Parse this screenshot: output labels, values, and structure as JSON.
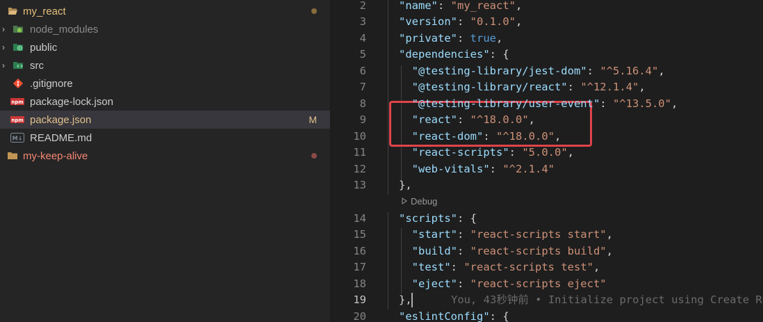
{
  "explorer": {
    "items": [
      {
        "label": "my_react",
        "type": "folder-open",
        "color": "#e5c07b",
        "status": "dot",
        "status_color": "#8a6d3b"
      },
      {
        "label": "node_modules",
        "type": "folder-node",
        "color": "#8c8c8c",
        "status": ""
      },
      {
        "label": "public",
        "type": "folder-public",
        "color": "#cccccc",
        "status": ""
      },
      {
        "label": "src",
        "type": "folder-src",
        "color": "#cccccc",
        "status": ""
      },
      {
        "label": ".gitignore",
        "type": "git",
        "color": "#cccccc",
        "status": ""
      },
      {
        "label": "package-lock.json",
        "type": "npm",
        "color": "#cccccc",
        "status": ""
      },
      {
        "label": "package.json",
        "type": "npm",
        "color": "#e2c08d",
        "status": "M",
        "status_color": "#e2c08d"
      },
      {
        "label": "README.md",
        "type": "markdown",
        "color": "#cccccc",
        "status": ""
      },
      {
        "label": "my-keep-alive",
        "type": "folder-closed",
        "color": "#f48771",
        "status": "dot",
        "status_color": "#8b4a45"
      }
    ],
    "readme_icon_text": "M↓",
    "npm_icon_text": "npm"
  },
  "editor": {
    "line_numbers": [
      "2",
      "3",
      "4",
      "5",
      "6",
      "7",
      "8",
      "9",
      "10",
      "11",
      "12",
      "13",
      "14",
      "15",
      "16",
      "17",
      "18",
      "19",
      "20"
    ],
    "active_line": "19",
    "codelens": "Debug",
    "blame": "You, 43秒钟前 • Initialize project using Create Re",
    "lines": [
      [
        {
          "t": "k",
          "v": "\"name\""
        },
        {
          "t": "p",
          "v": ": "
        },
        {
          "t": "s",
          "v": "\"my_react\""
        },
        {
          "t": "p",
          "v": ","
        }
      ],
      [
        {
          "t": "k",
          "v": "\"version\""
        },
        {
          "t": "p",
          "v": ": "
        },
        {
          "t": "s",
          "v": "\"0.1.0\""
        },
        {
          "t": "p",
          "v": ","
        }
      ],
      [
        {
          "t": "k",
          "v": "\"private\""
        },
        {
          "t": "p",
          "v": ": "
        },
        {
          "t": "b",
          "v": "true"
        },
        {
          "t": "p",
          "v": ","
        }
      ],
      [
        {
          "t": "k",
          "v": "\"dependencies\""
        },
        {
          "t": "p",
          "v": ": {"
        }
      ],
      [
        {
          "t": "p",
          "v": "  "
        },
        {
          "t": "k",
          "v": "\"@testing-library/jest-dom\""
        },
        {
          "t": "p",
          "v": ": "
        },
        {
          "t": "s",
          "v": "\"^5.16.4\""
        },
        {
          "t": "p",
          "v": ","
        }
      ],
      [
        {
          "t": "p",
          "v": "  "
        },
        {
          "t": "k",
          "v": "\"@testing-library/react\""
        },
        {
          "t": "p",
          "v": ": "
        },
        {
          "t": "s",
          "v": "\"^12.1.4\""
        },
        {
          "t": "p",
          "v": ","
        }
      ],
      [
        {
          "t": "p",
          "v": "  "
        },
        {
          "t": "k",
          "v": "\"@testing-library/user-event\""
        },
        {
          "t": "p",
          "v": ": "
        },
        {
          "t": "s",
          "v": "\"^13.5.0\""
        },
        {
          "t": "p",
          "v": ","
        }
      ],
      [
        {
          "t": "p",
          "v": "  "
        },
        {
          "t": "k",
          "v": "\"react\""
        },
        {
          "t": "p",
          "v": ": "
        },
        {
          "t": "s",
          "v": "\"^18.0.0\""
        },
        {
          "t": "p",
          "v": ","
        }
      ],
      [
        {
          "t": "p",
          "v": "  "
        },
        {
          "t": "k",
          "v": "\"react-dom\""
        },
        {
          "t": "p",
          "v": ": "
        },
        {
          "t": "s",
          "v": "\"^18.0.0\""
        },
        {
          "t": "p",
          "v": ","
        }
      ],
      [
        {
          "t": "p",
          "v": "  "
        },
        {
          "t": "k",
          "v": "\"react-scripts\""
        },
        {
          "t": "p",
          "v": ": "
        },
        {
          "t": "s",
          "v": "\"5.0.0\""
        },
        {
          "t": "p",
          "v": ","
        }
      ],
      [
        {
          "t": "p",
          "v": "  "
        },
        {
          "t": "k",
          "v": "\"web-vitals\""
        },
        {
          "t": "p",
          "v": ": "
        },
        {
          "t": "s",
          "v": "\"^2.1.4\""
        }
      ],
      [
        {
          "t": "p",
          "v": "},"
        }
      ],
      [
        {
          "t": "k",
          "v": "\"scripts\""
        },
        {
          "t": "p",
          "v": ": {"
        }
      ],
      [
        {
          "t": "p",
          "v": "  "
        },
        {
          "t": "k",
          "v": "\"start\""
        },
        {
          "t": "p",
          "v": ": "
        },
        {
          "t": "s",
          "v": "\"react-scripts start\""
        },
        {
          "t": "p",
          "v": ","
        }
      ],
      [
        {
          "t": "p",
          "v": "  "
        },
        {
          "t": "k",
          "v": "\"build\""
        },
        {
          "t": "p",
          "v": ": "
        },
        {
          "t": "s",
          "v": "\"react-scripts build\""
        },
        {
          "t": "p",
          "v": ","
        }
      ],
      [
        {
          "t": "p",
          "v": "  "
        },
        {
          "t": "k",
          "v": "\"test\""
        },
        {
          "t": "p",
          "v": ": "
        },
        {
          "t": "s",
          "v": "\"react-scripts test\""
        },
        {
          "t": "p",
          "v": ","
        }
      ],
      [
        {
          "t": "p",
          "v": "  "
        },
        {
          "t": "k",
          "v": "\"eject\""
        },
        {
          "t": "p",
          "v": ": "
        },
        {
          "t": "s",
          "v": "\"react-scripts eject\""
        }
      ],
      [
        {
          "t": "p",
          "v": "},"
        }
      ],
      [
        {
          "t": "k",
          "v": "\"eslintConfig\""
        },
        {
          "t": "p",
          "v": ": {"
        }
      ]
    ],
    "colors": {
      "highlight": "#e0434a"
    }
  }
}
